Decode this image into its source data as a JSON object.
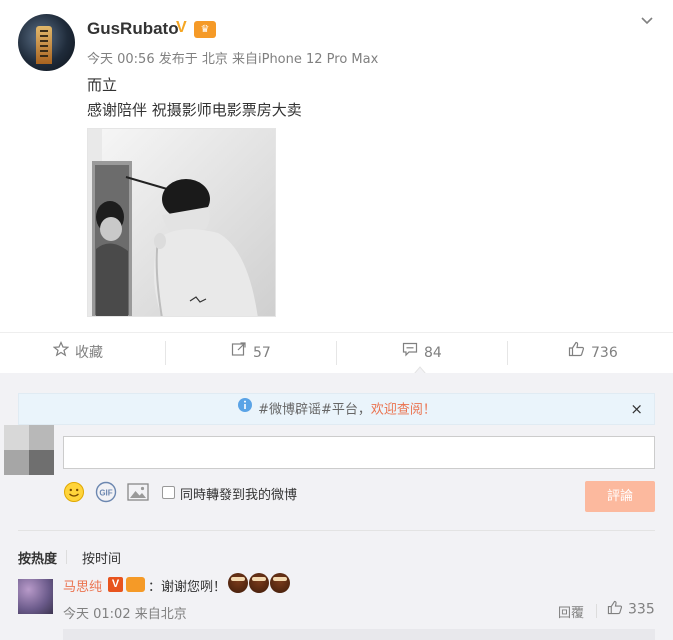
{
  "post": {
    "username": "GusRubato",
    "verified_mark": "V",
    "meta": "今天 00:56 发布于 北京 来自iPhone 12 Pro Max",
    "text_line1": "而立",
    "text_line2": "感谢陪伴 祝摄影师电影票房大卖"
  },
  "actions": {
    "favorite_label": "收藏",
    "repost_count": "57",
    "comment_count": "84",
    "like_count": "736"
  },
  "comment_area": {
    "notice_prefix": "#微博辟谣#平台，",
    "notice_link": "欢迎查阅！",
    "notice_close": "×",
    "input_placeholder": "",
    "repost_checkbox_label": "同時轉發到我的微博",
    "submit_label": "評論"
  },
  "sort": {
    "by_hot": "按热度",
    "by_time": "按时间"
  },
  "comments": [
    {
      "author": "马思纯",
      "badge": "V",
      "text": "：谢谢您咧！",
      "time": "今天 01:02 来自北京",
      "reply_label": "回覆",
      "likes": "335"
    }
  ],
  "colors": {
    "accent": "#eb7350",
    "submit_bg": "#fcb99e",
    "notice_bg": "#eaf4fb",
    "comments_bg": "#f2f2f5"
  }
}
